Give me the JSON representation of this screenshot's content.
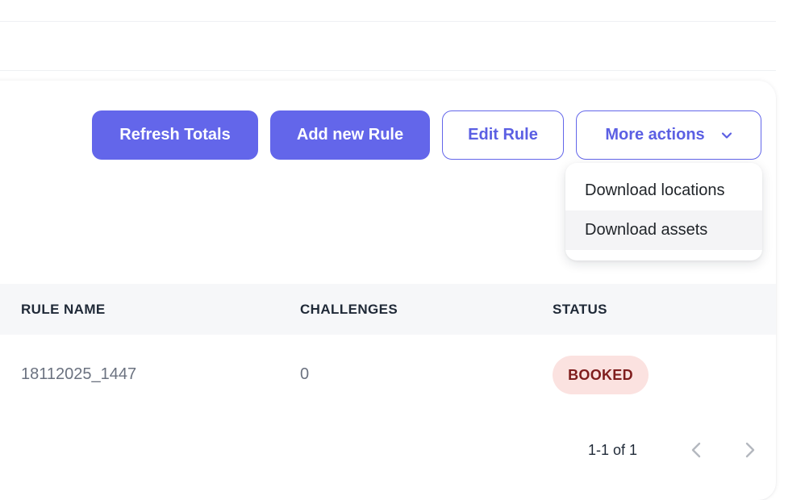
{
  "toolbar": {
    "refresh_label": "Refresh Totals",
    "add_label": "Add new Rule",
    "edit_label": "Edit Rule",
    "more_label": "More actions"
  },
  "menu": {
    "items": [
      {
        "label": "Download locations"
      },
      {
        "label": "Download assets"
      }
    ]
  },
  "table": {
    "columns": [
      "RULE NAME",
      "CHALLENGES",
      "STATUS"
    ],
    "rows": [
      {
        "rule_name": "18112025_1447",
        "challenges": "0",
        "status": "BOOKED"
      }
    ]
  },
  "pagination": {
    "range_text": "1-1 of 1"
  },
  "icons": {
    "more_actions_icon": "chevron-down-icon",
    "prev_icon": "chevron-left-icon",
    "next_icon": "chevron-right-icon"
  },
  "colors": {
    "accent": "#6366ea",
    "status_booked_bg": "#fbe2e0",
    "status_booked_text": "#7f1d1d"
  }
}
